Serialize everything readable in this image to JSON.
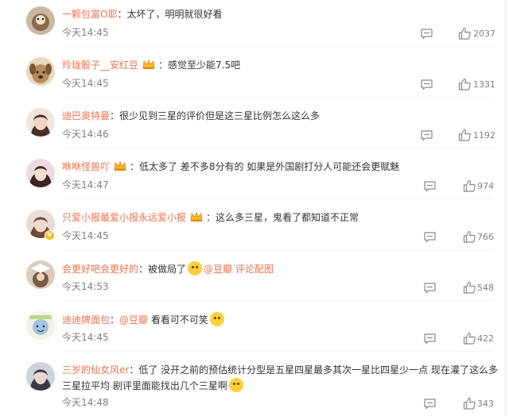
{
  "comments": [
    {
      "username": "一颗包富O耶",
      "text": "太坏了，明明就很好看",
      "time": "今天14:45",
      "likes": "2037",
      "avatar_color": "#8a6a4f",
      "badge": false,
      "verified": false
    },
    {
      "username": "玲珑骰子__安红豆",
      "text": "感觉至少能7.5吧",
      "time": "今天14:45",
      "likes": "1331",
      "avatar_color": "#b88b5a",
      "badge": true,
      "verified": false
    },
    {
      "username": "迪巴奥特曼",
      "text": "很少见到三星的评价但是这三星比例怎么这么多",
      "time": "今天14:46",
      "likes": "1192",
      "avatar_color": "#c9a28f",
      "badge": false,
      "verified": false
    },
    {
      "username": "咻咻怪兽吖",
      "text": "低太多了 差不多8分有的 如果是外国剧打分人可能还会更赋魅",
      "time": "今天14:47",
      "likes": "974",
      "avatar_color": "#d8b7b3",
      "badge": true,
      "verified": false
    },
    {
      "username": "只爱小报最爱小报永远爱小报",
      "text": "这么多三星，鬼看了都知道不正常",
      "time": "今天14:45",
      "likes": "766",
      "avatar_color": "#c6a99a",
      "badge": true,
      "verified": true
    },
    {
      "username": "会更好吧会更好的",
      "text": "被做局了",
      "mention": "@豆瓣",
      "link": "评论配图",
      "time": "今天14:53",
      "likes": "548",
      "avatar_color": "#7a5a44",
      "badge": false,
      "verified": false
    },
    {
      "username": "迪迪牌面包",
      "mention": "@豆瓣",
      "text": "看看可不可笑",
      "time": "今天14:45",
      "likes": "422",
      "avatar_color": "#9fc6e0",
      "badge": false,
      "verified": false
    },
    {
      "username": "三岁的仙女风er",
      "text": "低了 没开之前的预估统计分型是五星四星最多其次一星比四星少一点 现在灌了这么多",
      "text2": "三星拉平均 剧评里面能找出几个三星啊",
      "time": "今天14:48",
      "likes": "343",
      "avatar_color": "#5a5a6e",
      "badge": false,
      "verified": false
    }
  ],
  "colors": {
    "username": "#eb7350",
    "text": "#333333",
    "meta": "#808080"
  }
}
